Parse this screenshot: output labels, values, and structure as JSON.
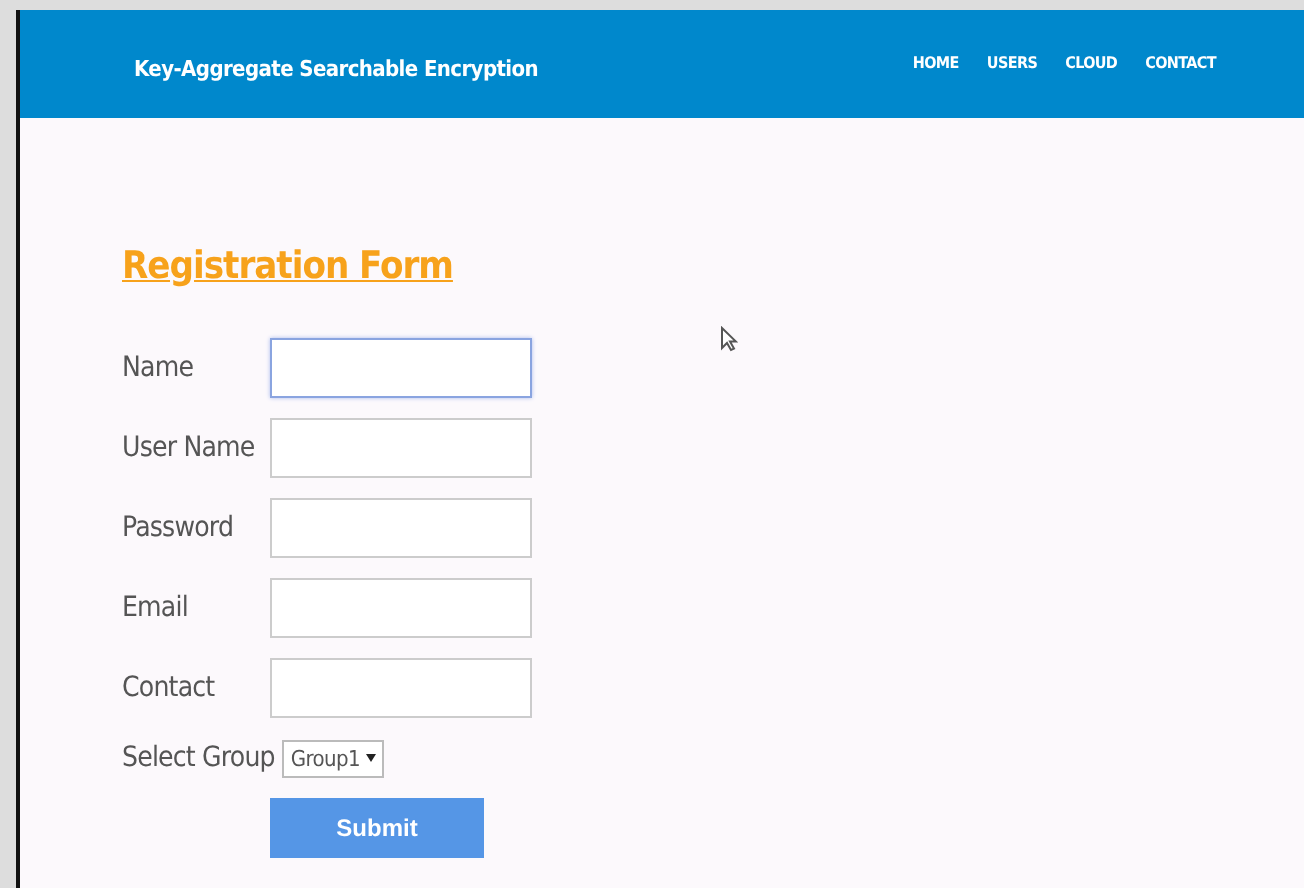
{
  "header": {
    "title": "Key-Aggregate Searchable Encryption",
    "nav": [
      "HOME",
      "USERS",
      "CLOUD",
      "CONTACT"
    ]
  },
  "form": {
    "title": "Registration Form",
    "fields": [
      {
        "label": "Name",
        "focused": true
      },
      {
        "label": "User Name",
        "focused": false
      },
      {
        "label": "Password",
        "focused": false
      },
      {
        "label": "Email",
        "focused": false
      },
      {
        "label": "Contact",
        "focused": false
      }
    ],
    "select": {
      "label": "Select Group",
      "value": "Group1"
    },
    "submit": "Submit"
  }
}
